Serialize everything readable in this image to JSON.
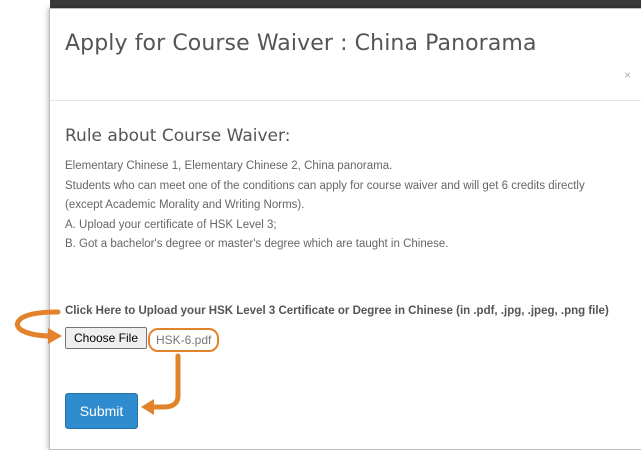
{
  "modal": {
    "title": "Apply for Course Waiver : China Panorama",
    "close_symbol": "×"
  },
  "rule": {
    "heading": "Rule about Course Waiver:",
    "lines": [
      "Elementary Chinese 1, Elementary Chinese 2, China panorama.",
      "Students who can meet one of the conditions can apply for course waiver and will get 6 credits directly",
      "(except Academic Morality and Writing Norms).",
      "A. Upload your certificate of HSK Level 3;",
      "B. Got a bachelor's degree or master's degree which are taught in Chinese."
    ]
  },
  "upload": {
    "label": "Click Here to Upload your HSK Level 3 Certificate or Degree in Chinese (in .pdf, .jpg, .jpeg, .png file)",
    "button_label": "Choose File",
    "file_name": "HSK-6.pdf"
  },
  "submit_label": "Submit",
  "colors": {
    "accent": "#e2832c",
    "primary_button": "#2e8ccf"
  },
  "icons": [
    "close-icon",
    "arrow-right-annotation",
    "arrow-down-left-annotation"
  ]
}
